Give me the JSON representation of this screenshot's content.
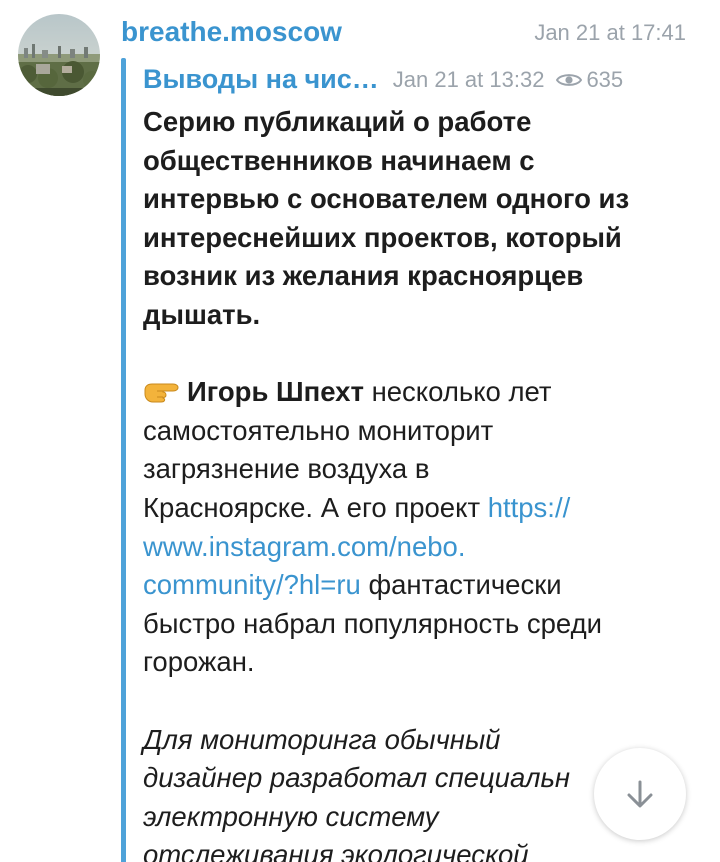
{
  "channel": {
    "name": "breathe.moscow",
    "time": "Jan 21 at 17:41"
  },
  "forward": {
    "title": "Выводы на чис…",
    "date": "Jan 21 at 13:32",
    "views": "635"
  },
  "message": {
    "bold_lines": [
      "Серию публикаций о работе",
      "общественников начинаем с",
      "интервью с основателем одного из",
      "интереснейших проектов, который",
      "возник из желания красноярцев",
      "дышать."
    ],
    "person_name": "Игорь Шпехт",
    "line1_rest": " несколько лет",
    "plain_lines": [
      "самостоятельно мониторит",
      "загрязнение воздуха в"
    ],
    "line4_text": "Красноярске. А его проект ",
    "link_part1": "https://",
    "link_part2": "www.instagram.com/nebo.",
    "link_part3": "community/?hl=ru",
    "after_link": " фантастически",
    "tail_lines": [
      "быстро набрал популярность среди",
      "горожан."
    ],
    "italic_lines": [
      "Для мониторинга обычный",
      "дизайнер разработал специальн",
      "электронную систему",
      "отслеживания экологической"
    ]
  },
  "icons": {
    "avatar": "city-skyline-avatar",
    "views": "eye-icon",
    "emoji": "pointing-hand-icon",
    "scroll": "arrow-down-icon"
  },
  "colors": {
    "accent": "#3a94cf",
    "bar": "#4ea2d9",
    "meta": "#9ba3ab",
    "text": "#1d1d1d"
  }
}
